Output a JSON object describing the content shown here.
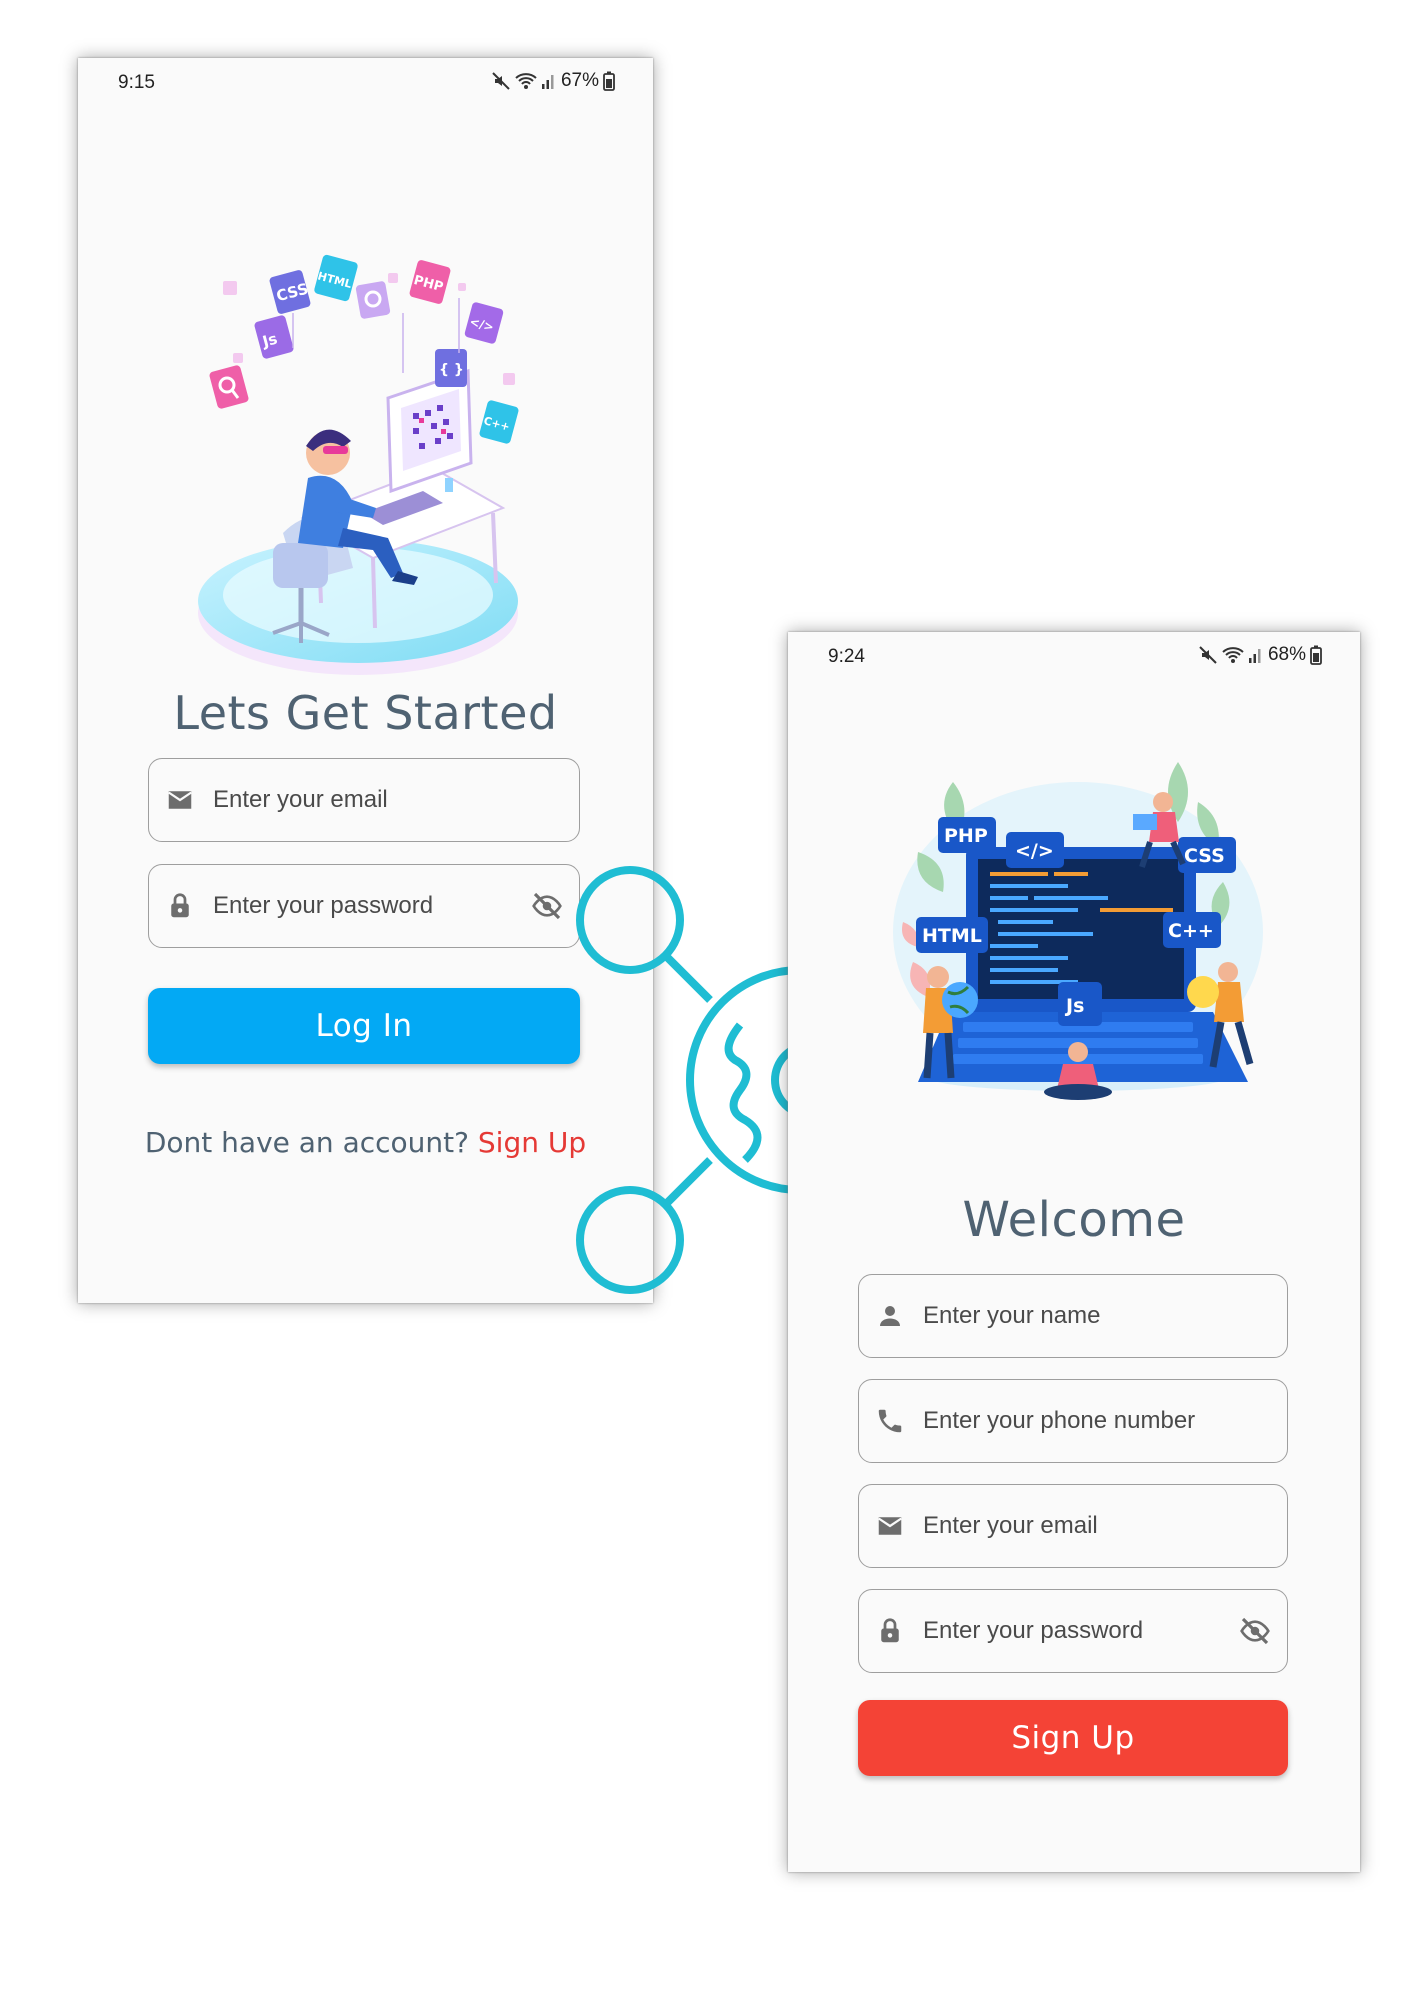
{
  "login": {
    "status": {
      "time": "9:15",
      "battery": "67%"
    },
    "title": "Lets Get Started",
    "email_placeholder": "Enter your email",
    "password_placeholder": "Enter your password",
    "login_button": "Log In",
    "no_account_text": "Dont have an account?",
    "signup_link": "Sign Up",
    "illustration_tags": [
      "CSS",
      "HTML",
      "PHP",
      "Js",
      "</>",
      "{ }",
      "C++"
    ]
  },
  "signup": {
    "status": {
      "time": "9:24",
      "battery": "68%"
    },
    "title": "Welcome",
    "name_placeholder": "Enter your name",
    "phone_placeholder": "Enter your phone number",
    "email_placeholder": "Enter your email",
    "password_placeholder": "Enter your password",
    "signup_button": "Sign Up",
    "illustration_tags": [
      "PHP",
      "</>",
      "CSS",
      "HTML",
      "C++",
      "Js"
    ]
  },
  "icons": {
    "mute": "mute-icon",
    "wifi": "wifi-icon",
    "signal": "signal-icon",
    "battery": "battery-icon",
    "email": "email-icon",
    "lock": "lock-icon",
    "visibility_off": "visibility-off-icon",
    "person": "person-icon",
    "phone": "phone-icon",
    "connector": "gear-connector-icon"
  },
  "colors": {
    "login_button": "#03a9f4",
    "signup_button": "#f44336",
    "signup_link": "#e53935",
    "title_text": "#4f6272",
    "connector": "#1fbdd3"
  }
}
